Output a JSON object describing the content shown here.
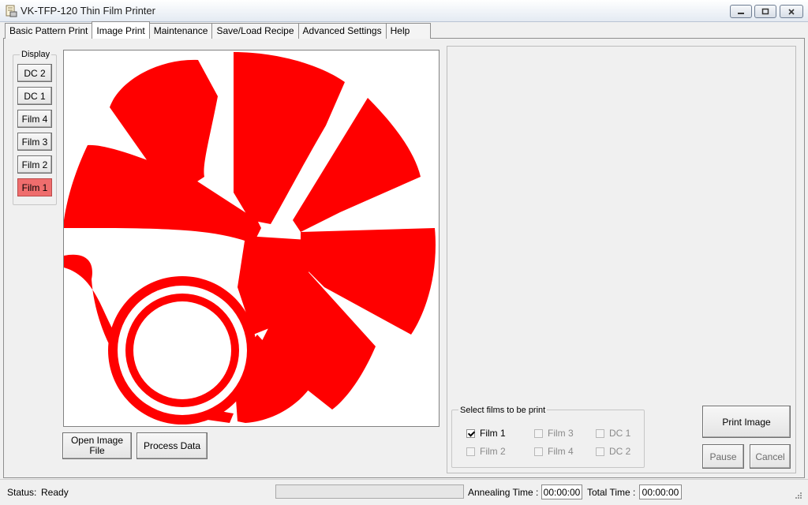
{
  "window": {
    "title": "VK-TFP-120 Thin Film Printer",
    "icon": "printer-document-icon",
    "controls": [
      "minimize-icon",
      "restore-icon",
      "close-icon"
    ]
  },
  "tabs": [
    {
      "label": "Basic Pattern Print",
      "active": false
    },
    {
      "label": "Image Print",
      "active": true
    },
    {
      "label": "Maintenance",
      "active": false
    },
    {
      "label": "Save/Load Recipe",
      "active": false
    },
    {
      "label": "Advanced Settings",
      "active": false
    },
    {
      "label": "Help",
      "active": false
    }
  ],
  "display": {
    "label": "Display",
    "buttons": [
      {
        "label": "DC 2",
        "selected": false
      },
      {
        "label": "DC 1",
        "selected": false
      },
      {
        "label": "Film 4",
        "selected": false
      },
      {
        "label": "Film 3",
        "selected": false
      },
      {
        "label": "Film 2",
        "selected": false
      },
      {
        "label": "Film 1",
        "selected": true
      }
    ]
  },
  "image": {
    "content": "red-fan-logo",
    "color": "#ff0000"
  },
  "actions": {
    "open_image": "Open Image File",
    "process_data": "Process Data",
    "print_image": "Print Image",
    "pause": "Pause",
    "cancel": "Cancel"
  },
  "film_select": {
    "label": "Select films to be print",
    "options": [
      {
        "label": "Film 1",
        "checked": true,
        "enabled": true
      },
      {
        "label": "Film 3",
        "checked": false,
        "enabled": false
      },
      {
        "label": "DC 1",
        "checked": false,
        "enabled": false
      },
      {
        "label": "Film 2",
        "checked": false,
        "enabled": false
      },
      {
        "label": "Film 4",
        "checked": false,
        "enabled": false
      },
      {
        "label": "DC 2",
        "checked": false,
        "enabled": false
      }
    ]
  },
  "status": {
    "label": "Status:",
    "value": "Ready",
    "annealing_label": "Annealing Time :",
    "annealing_value": "00:00:00",
    "total_label": "Total Time :",
    "total_value": "00:00:00",
    "progress": 0
  },
  "colors": {
    "selected_button": "#ef6d6d",
    "image_fill": "#ff0000"
  }
}
